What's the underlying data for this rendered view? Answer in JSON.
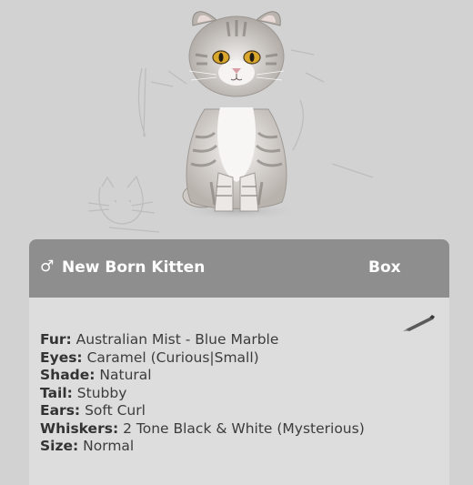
{
  "header": {
    "gender_symbol": "♂",
    "pet_name": "New Born Kitten",
    "box_label": "Box"
  },
  "traits": [
    {
      "key": "Fur:",
      "value": "Australian Mist - Blue Marble"
    },
    {
      "key": "Eyes:",
      "value": "Caramel (Curious|Small)"
    },
    {
      "key": "Shade:",
      "value": "Natural"
    },
    {
      "key": "Tail:",
      "value": "Stubby"
    },
    {
      "key": "Ears:",
      "value": "Soft Curl"
    },
    {
      "key": "Whiskers:",
      "value": "2 Tone Black & White (Mysterious)"
    },
    {
      "key": "Size:",
      "value": "Normal"
    }
  ],
  "icons": {
    "gender": "male-icon",
    "edit": "pencil-icon"
  },
  "colors": {
    "background": "#d2d2d2",
    "panel_header": "#8e8e8e",
    "panel_body": "#dddddd",
    "header_text": "#ffffff",
    "body_text": "#3c3c3c"
  }
}
